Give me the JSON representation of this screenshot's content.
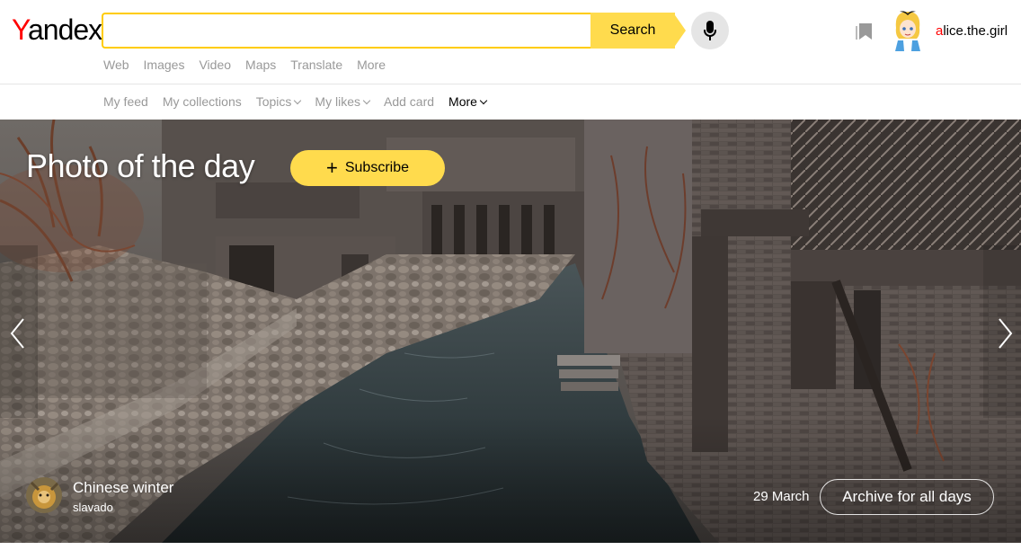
{
  "logo": {
    "first_letter": "Y",
    "rest": "andex"
  },
  "search": {
    "value": "",
    "placeholder": "",
    "button_label": "Search"
  },
  "user": {
    "first_letter": "a",
    "rest": "lice.the.girl"
  },
  "services": [
    "Web",
    "Images",
    "Video",
    "Maps",
    "Translate",
    "More"
  ],
  "subnav": [
    {
      "label": "My feed",
      "dropdown": false
    },
    {
      "label": "My collections",
      "dropdown": false
    },
    {
      "label": "Topics",
      "dropdown": true
    },
    {
      "label": "My likes",
      "dropdown": true
    },
    {
      "label": "Add card",
      "dropdown": false
    },
    {
      "label": "More",
      "dropdown": true,
      "active": true
    }
  ],
  "hero": {
    "title": "Photo of the day",
    "subscribe_label": "Subscribe",
    "photo_name": "Chinese winter",
    "author": "slavado",
    "date": "29 March",
    "archive_label": "Archive for all days"
  },
  "colors": {
    "accent": "#ffdb4d",
    "search_border": "#ffcc00",
    "logo_red": "#ff0000",
    "muted": "#999999"
  }
}
